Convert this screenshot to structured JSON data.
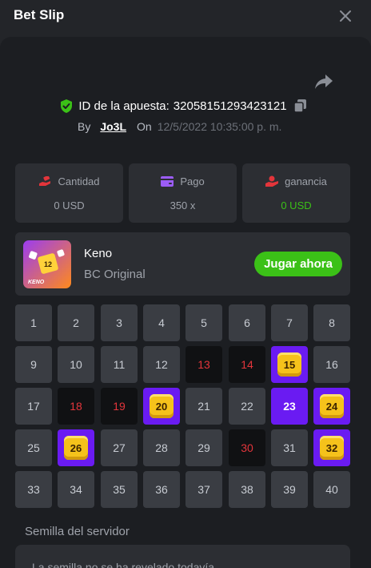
{
  "header": {
    "title": "Bet Slip"
  },
  "bet": {
    "id_label": "ID de la apuesta:",
    "id": "3205815129342312​1",
    "by_label": "By",
    "user": "Jo3L",
    "on_label": "On",
    "date": "12/5/2022 10:35:00 p. m."
  },
  "stats": [
    {
      "icon": "money-hand-icon",
      "label": "Cantidad",
      "value": "0 USD",
      "color": "#e3353b"
    },
    {
      "icon": "wallet-icon",
      "label": "Pago",
      "value": "350 x",
      "color": "#9b5cf6"
    },
    {
      "icon": "payout-hand-icon",
      "label": "ganancia",
      "value": "0 USD",
      "color": "#e3353b",
      "value_color": "#3bc117"
    }
  ],
  "game": {
    "name": "Keno",
    "subtitle": "BC Original",
    "play_label": "Jugar ahora",
    "thumb_text": "KENO",
    "thumb_number": "12"
  },
  "keno": {
    "numbers": [
      "1",
      "2",
      "3",
      "4",
      "5",
      "6",
      "7",
      "8",
      "9",
      "10",
      "11",
      "12",
      "13",
      "14",
      "15",
      "16",
      "17",
      "18",
      "19",
      "20",
      "21",
      "22",
      "23",
      "24",
      "25",
      "26",
      "27",
      "28",
      "29",
      "30",
      "31",
      "32",
      "33",
      "34",
      "35",
      "36",
      "37",
      "38",
      "39",
      "40"
    ],
    "missed_picks": [
      "13",
      "14",
      "18",
      "19",
      "30"
    ],
    "hits_gem": [
      "15",
      "20",
      "24",
      "26",
      "32"
    ],
    "hits_plain": [
      "23"
    ]
  },
  "seed": {
    "label": "Semilla del servidor",
    "text": "La semilla no se ha revelado todavía"
  },
  "colors": {
    "accent_green": "#3bc117",
    "hit_purple": "#6a1bf2",
    "miss_red": "#e3353b",
    "gem_gold": "#f5c21b"
  }
}
